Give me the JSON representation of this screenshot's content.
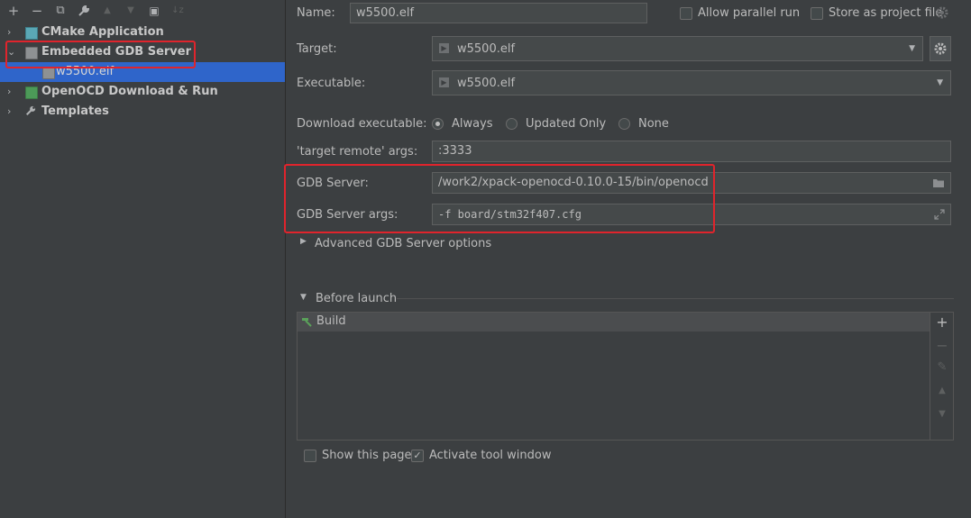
{
  "toolbar": {
    "add": "+",
    "remove": "−",
    "copy": "⧉",
    "edit": "🔧",
    "up": "▲",
    "down": "▼",
    "new_folder": "▣",
    "sort": "↓z"
  },
  "tree": {
    "items": [
      {
        "label": "CMake Application",
        "icon": "cmake-icon"
      },
      {
        "label": "Embedded GDB Server",
        "icon": "chip-icon"
      },
      {
        "label": "w5500.elf",
        "icon": "chip-icon"
      },
      {
        "label": "OpenOCD Download & Run",
        "icon": "chip-green-icon"
      },
      {
        "label": "Templates",
        "icon": "wrench-icon"
      }
    ]
  },
  "form": {
    "name_label": "Name:",
    "name_value": "w5500.elf",
    "allow_parallel": "Allow parallel run",
    "store_project": "Store as project file",
    "target_label": "Target:",
    "target_value": "w5500.elf",
    "executable_label": "Executable:",
    "executable_value": "w5500.elf",
    "download_label": "Download executable:",
    "download_options": [
      "Always",
      "Updated Only",
      "None"
    ],
    "download_selected": "Always",
    "target_remote_label": "'target remote' args:",
    "target_remote_value": ":3333",
    "gdb_server_label": "GDB Server:",
    "gdb_server_value": "/work2/xpack-openocd-0.10.0-15/bin/openocd",
    "gdb_args_label": "GDB Server args:",
    "gdb_args_value": "-f board/stm32f407.cfg",
    "advanced_label": "Advanced GDB Server options",
    "before_launch_label": "Before launch",
    "before_launch_items": [
      "Build"
    ],
    "show_page": "Show this page",
    "activate_tool": "Activate tool window"
  },
  "colors": {
    "background": "#3c3f41",
    "selection": "#2f65ca",
    "annotation_red": "#e0242c"
  }
}
